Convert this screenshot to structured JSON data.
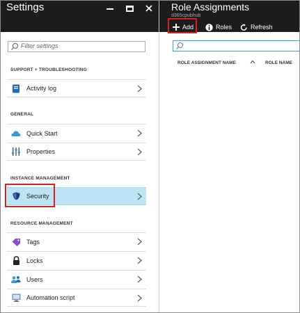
{
  "settings": {
    "title": "Settings",
    "filter_placeholder": "Filter settings",
    "sections": [
      {
        "label": "SUPPORT + TROUBLESHOOTING",
        "items": [
          {
            "label": "Activity log",
            "icon": "activity-log-icon"
          }
        ]
      },
      {
        "label": "GENERAL",
        "items": [
          {
            "label": "Quick Start",
            "icon": "cloud-icon"
          },
          {
            "label": "Properties",
            "icon": "properties-icon"
          }
        ]
      },
      {
        "label": "INSTANCE MANAGEMENT",
        "items": [
          {
            "label": "Security",
            "icon": "shield-icon",
            "selected": true
          }
        ]
      },
      {
        "label": "RESOURCE MANAGEMENT",
        "items": [
          {
            "label": "Tags",
            "icon": "tag-icon"
          },
          {
            "label": "Locks",
            "icon": "lock-icon"
          },
          {
            "label": "Users",
            "icon": "users-icon"
          },
          {
            "label": "Automation script",
            "icon": "automation-script-icon"
          }
        ]
      }
    ]
  },
  "role_assignments": {
    "title": "Role Assignments",
    "subtitle": "d365cpubhub",
    "toolbar": {
      "add_label": "Add",
      "roles_label": "Roles",
      "refresh_label": "Refresh"
    },
    "columns": [
      "ROLE ASSIGNMENT NAME",
      "ROLE NAME"
    ]
  },
  "colors": {
    "header_bg": "#1c1c1c",
    "selected_row": "#bde4f4",
    "highlight_red": "#d81e1e",
    "accent_blue": "#2fa4d8"
  }
}
